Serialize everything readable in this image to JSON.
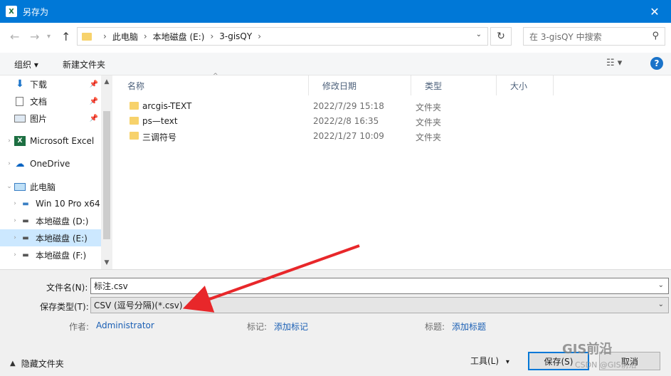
{
  "window": {
    "title": "另存为",
    "app_badge": "X",
    "close": "✕"
  },
  "address": {
    "crumbs": [
      "此电脑",
      "本地磁盘 (E:)",
      "3-gisQY"
    ],
    "search_placeholder": "在 3-gisQY 中搜索"
  },
  "toolbar": {
    "organize": "组织 ▾",
    "new_folder": "新建文件夹",
    "help": "?"
  },
  "nav": {
    "items": [
      {
        "label": "下载",
        "icon": "download-arrow-icon",
        "pinned": true
      },
      {
        "label": "文档",
        "icon": "document-icon",
        "pinned": true
      },
      {
        "label": "图片",
        "icon": "picture-icon",
        "pinned": true
      },
      {
        "label": "Microsoft Excel",
        "icon": "excel-icon"
      },
      {
        "label": "OneDrive",
        "icon": "cloud-icon"
      },
      {
        "label": "此电脑",
        "icon": "pc-icon"
      },
      {
        "label": "Win 10 Pro x64",
        "icon": "network-drive-icon"
      },
      {
        "label": "本地磁盘 (D:)",
        "icon": "disk-icon"
      },
      {
        "label": "本地磁盘 (E:)",
        "icon": "disk-icon",
        "selected": true
      },
      {
        "label": "本地磁盘 (F:)",
        "icon": "disk-icon"
      }
    ]
  },
  "columns": {
    "name": "名称",
    "modified": "修改日期",
    "type": "类型",
    "size": "大小"
  },
  "files": [
    {
      "name": "arcgis-TEXT",
      "modified": "2022/7/29 15:18",
      "type": "文件夹"
    },
    {
      "name": "ps—text",
      "modified": "2022/2/8 16:35",
      "type": "文件夹"
    },
    {
      "name": "三调符号",
      "modified": "2022/1/27 10:09",
      "type": "文件夹"
    }
  ],
  "form": {
    "filename_label": "文件名(N):",
    "filename_value": "标注.csv",
    "filetype_label": "保存类型(T):",
    "filetype_value": "CSV (逗号分隔)(*.csv)",
    "author_label": "作者:",
    "author_value": "Administrator",
    "tags_label": "标记:",
    "tags_value": "添加标记",
    "title_label": "标题:",
    "title_value": "添加标题"
  },
  "footer": {
    "hide_folders": "隐藏文件夹",
    "tools": "工具(L)",
    "save": "保存(S)",
    "cancel": "取消"
  },
  "watermark": {
    "brand": "GIS前沿",
    "credit": "CSDN @GIS前沿"
  },
  "colors": {
    "titlebar": "#0078d7",
    "selection": "#cce8ff",
    "annotation_arrow": "#e8272a",
    "link": "#1a5fb4"
  }
}
